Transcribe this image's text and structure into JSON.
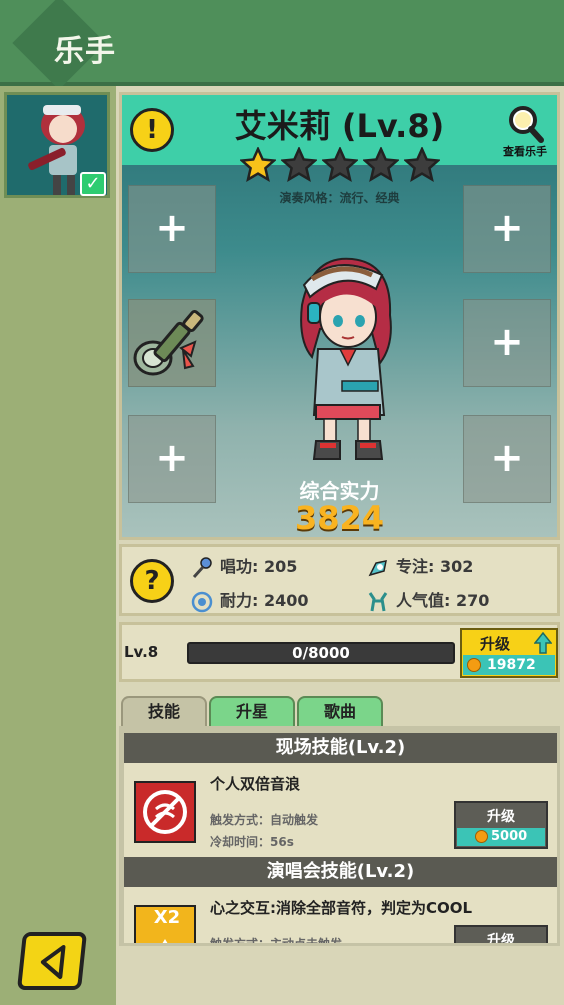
{
  "header": {
    "title": "乐手"
  },
  "character": {
    "name": "艾米莉 (Lv.8)",
    "view_label": "查看乐手",
    "stars_filled": 1,
    "stars_total": 5,
    "style_text": "演奏风格：流行、经典",
    "power_label": "综合实力",
    "power_value": "3824"
  },
  "equipment_slots": {
    "plus": "+"
  },
  "stats": {
    "sing": "唱功: 205",
    "focus": "专注: 302",
    "stamina": "耐力: 2400",
    "popularity": "人气值: 270"
  },
  "level": {
    "label": "Lv.8",
    "xp_text": "0/8000",
    "xp_fraction": 0,
    "upgrade_label": "升级",
    "upgrade_cost": "19872"
  },
  "tabs": [
    {
      "label": "技能"
    },
    {
      "label": "升星"
    },
    {
      "label": "歌曲"
    }
  ],
  "skills": [
    {
      "header": "现场技能(Lv.2)",
      "name": "个人双倍音浪",
      "trigger": "触发方式：自动触发",
      "cooldown": "冷却时间：56s",
      "button_label": "升级",
      "cost": "5000"
    },
    {
      "header": "演唱会技能(Lv.2)",
      "name": "心之交互:消除全部音符，判定为COOL",
      "trigger": "触发方式：主动点击触发",
      "button_label": "升级",
      "icon_text": "X2"
    }
  ],
  "colors": {
    "top_bar": "#4f8f5a",
    "panel_head": "#3ecfa8",
    "accent_yellow": "#f7d117",
    "cost_teal": "#3bc4b6",
    "power_orange": "#f9b320"
  }
}
